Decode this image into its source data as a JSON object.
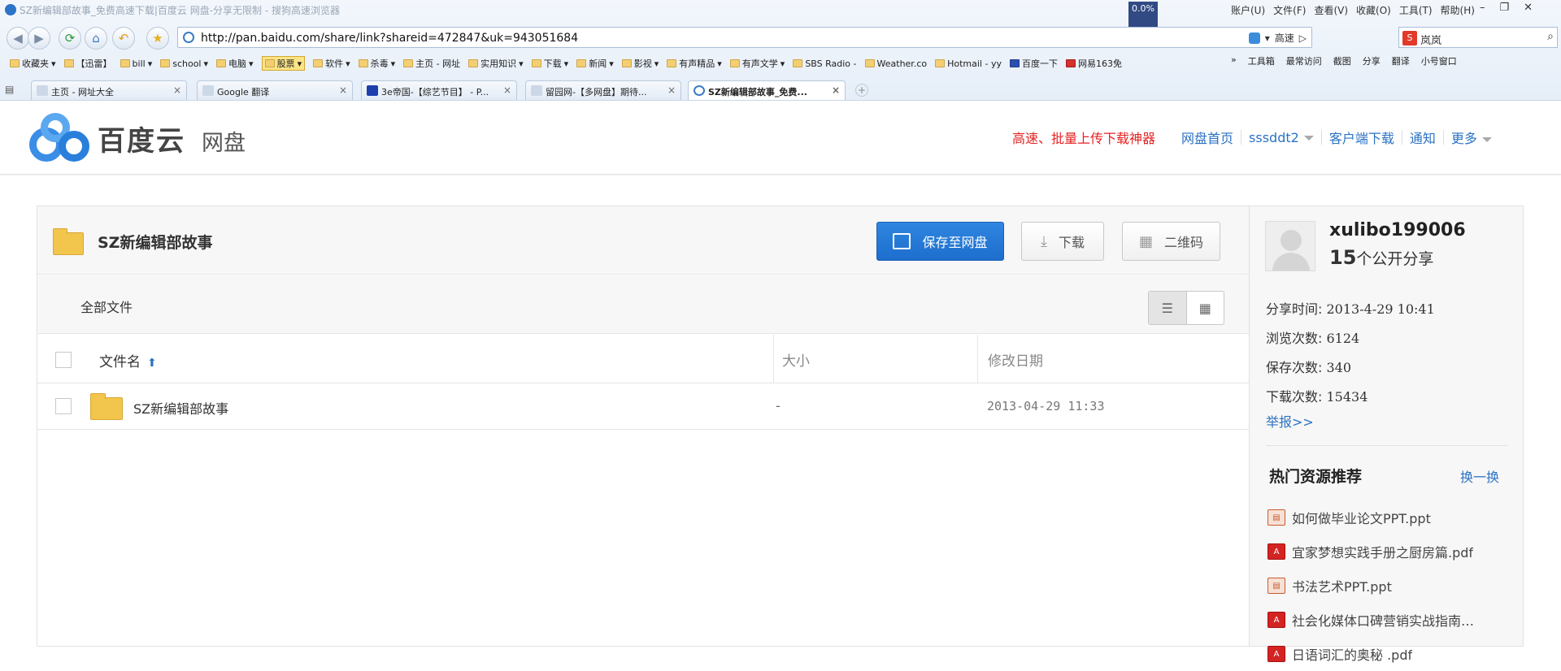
{
  "browser": {
    "window_title": "SZ新编辑部故事_免费高速下载|百度云 网盘-分享无限制 - 搜狗高速浏览器",
    "cpu_badge": "0.0%",
    "menu": [
      "账户(U)",
      "文件(F)",
      "查看(V)",
      "收藏(O)",
      "工具(T)",
      "帮助(H)"
    ],
    "address": "http://pan.baidu.com/share/link?shareid=472847&uk=943051684",
    "speed_label": "高速",
    "search_query": "岚岚",
    "bookmarks": [
      "收藏夹",
      "【迅雷】",
      "bill",
      "school",
      "电脑",
      "股票",
      "软件",
      "杀毒",
      "主页 - 网址",
      "实用知识",
      "下载",
      "新闻",
      "影视",
      "有声精品",
      "有声文学",
      "SBS Radio -",
      "Weather.co",
      "Hotmail - yy",
      "百度一下",
      "网易163免"
    ],
    "toolbar_right": [
      "工具箱",
      "最常访问",
      "截图",
      "分享",
      "翻译",
      "小号窗口"
    ],
    "tabs": [
      {
        "label": "主页 - 网址大全"
      },
      {
        "label": "Google 翻译"
      },
      {
        "label": "3e帝国-【综艺节目】 - P..."
      },
      {
        "label": "留园网-【多网盘】期待..."
      },
      {
        "label": "SZ新编辑部故事_免费..."
      }
    ]
  },
  "site": {
    "brand": "百度云",
    "brand_sub": "网盘",
    "promo": "高速、批量上传下载神器",
    "nav": [
      "网盘首页",
      "sssddt2",
      "客户端下载",
      "通知",
      "更多"
    ]
  },
  "share": {
    "title": "SZ新编辑部故事",
    "save_button": "保存至网盘",
    "download_button": "下载",
    "qrcode_button": "二维码",
    "breadcrumb": "全部文件",
    "columns": {
      "name": "文件名",
      "size": "大小",
      "date": "修改日期"
    },
    "rows": [
      {
        "name": "SZ新编辑部故事",
        "size": "-",
        "date": "2013-04-29 11:33"
      }
    ]
  },
  "sharer": {
    "username": "xulibo199006",
    "share_count": "15",
    "share_count_suffix": "个公开分享",
    "stats": [
      {
        "label": "分享时间:",
        "value": "2013-4-29 10:41"
      },
      {
        "label": "浏览次数:",
        "value": "6124"
      },
      {
        "label": "保存次数:",
        "value": "340"
      },
      {
        "label": "下载次数:",
        "value": "15434"
      }
    ],
    "report": "举报>>",
    "hot_title": "热门资源推荐",
    "swap": "换一换",
    "hot": [
      {
        "type": "ppt",
        "name": "如何做毕业论文PPT.ppt"
      },
      {
        "type": "pdf",
        "name": "宜家梦想实践手册之厨房篇.pdf"
      },
      {
        "type": "ppt",
        "name": "书法艺术PPT.ppt"
      },
      {
        "type": "pdf",
        "name": "社会化媒体口碑营销实战指南…"
      },
      {
        "type": "pdf",
        "name": "日语词汇的奥秘 .pdf"
      }
    ]
  },
  "colors": {
    "accent": "#2b72c4",
    "primary_button": "#1d6ecd",
    "promo": "#e52222",
    "folder": "#f2c54c"
  }
}
